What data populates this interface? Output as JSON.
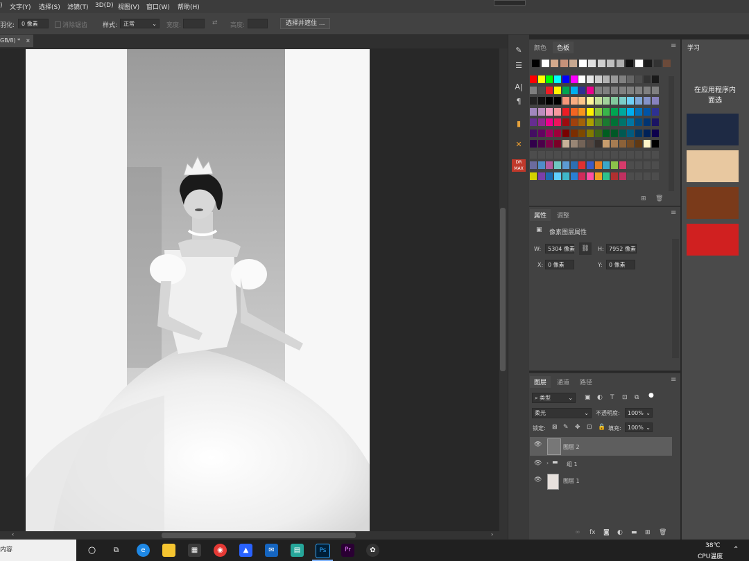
{
  "menubar": {
    "items": [
      "文字(Y)",
      "选择(S)",
      "滤镜(T)",
      "3D(D)",
      "视图(V)",
      "窗口(W)",
      "帮助(H)"
    ],
    "left_fragment": ")"
  },
  "options": {
    "feather_label": "羽化:",
    "feather_value": "0 像素",
    "antialias_label": "消除锯齿",
    "style_label": "样式:",
    "style_value": "正常",
    "width_label": "宽度:",
    "height_label": "高度:",
    "select_mask_btn": "选择并遮住 ..."
  },
  "document_tab": {
    "label": "GB/8) *",
    "close": "×"
  },
  "swatches_panel": {
    "tab_color": "颜色",
    "tab_swatches": "色板",
    "recent": [
      "#000000",
      "#ffffff",
      "#d4a98c",
      "#c6927a",
      "#c8a890",
      "#ffffff",
      "#e0e0e0",
      "#d0d0d0",
      "#c0c0c0",
      "#b0b0b0",
      "#111111",
      "#ffffff",
      "#1a1a1a",
      "#333333",
      "#6b4a3a"
    ],
    "rows": [
      [
        "#ff0000",
        "#ffff00",
        "#00ff00",
        "#00ffff",
        "#0000ff",
        "#ff00ff",
        "#ffffff",
        "#e6e6e6",
        "#cccccc",
        "#b3b3b3",
        "#999999",
        "#808080",
        "#666666",
        "#4d4d4d",
        "#333333",
        "#1a1a1a"
      ],
      [
        "#7f7f7f",
        "#4d4d4d",
        "#ed1c24",
        "#fff200",
        "#00a651",
        "#00aeef",
        "#2e3192",
        "#ec008c",
        "#808080",
        "#808080",
        "#808080",
        "#808080",
        "#808080",
        "#808080",
        "#808080",
        "#808080"
      ],
      [
        "#222222",
        "#111111",
        "#000000",
        "#000000",
        "#f7977a",
        "#f9ad81",
        "#fdc68a",
        "#fff79a",
        "#c4df9b",
        "#a2d39c",
        "#82ca9d",
        "#7bcdc8",
        "#6ecff6",
        "#7ea7d8",
        "#8493ca",
        "#8882be"
      ],
      [
        "#a187be",
        "#bc8dbf",
        "#f49ac2",
        "#f6989d",
        "#ed1c24",
        "#f26522",
        "#f7941d",
        "#fff200",
        "#8dc73f",
        "#39b54a",
        "#00a651",
        "#00a99d",
        "#00aeef",
        "#0072bc",
        "#0054a6",
        "#2e3192"
      ],
      [
        "#662d91",
        "#92278f",
        "#ec008c",
        "#ed145b",
        "#9e0b0f",
        "#a0410d",
        "#a36209",
        "#aba000",
        "#598527",
        "#1a7b30",
        "#007236",
        "#00746b",
        "#0076a3",
        "#004b80",
        "#003471",
        "#1b1464"
      ],
      [
        "#440e62",
        "#630460",
        "#9e005d",
        "#9e0039",
        "#790000",
        "#7b2e00",
        "#7d4900",
        "#827b00",
        "#406618",
        "#005e20",
        "#005826",
        "#005952",
        "#005b7f",
        "#003663",
        "#002157",
        "#0d004c"
      ],
      [
        "#32004b",
        "#4b0049",
        "#7b0046",
        "#7a0026",
        "#c7b299",
        "#998675",
        "#736357",
        "#534741",
        "#37302d",
        "#c69c6d",
        "#a67c52",
        "#8c6239",
        "#754c24",
        "#603913",
        "#fff6c9",
        "#000000"
      ],
      [
        "#4d4d4d",
        "#4d4d4d",
        "#4d4d4d",
        "#4d4d4d",
        "#4d4d4d",
        "#4d4d4d",
        "#4d4d4d",
        "#4d4d4d",
        "#4d4d4d",
        "#4d4d4d",
        "#4d4d4d",
        "#4d4d4d",
        "#4d4d4d",
        "#4d4d4d",
        "#4d4d4d",
        "#4d4d4d"
      ],
      [
        "#6b6b9e",
        "#4f8dc8",
        "#b45ca0",
        "#6fc7c1",
        "#5c9bd3",
        "#2d6fb2",
        "#e03030",
        "#3b5bc7",
        "#e67e22",
        "#3aa7c9",
        "#8bc34a",
        "#d63b6b",
        "#4d4d4d",
        "#4d4d4d",
        "#4d4d4d",
        "#4d4d4d"
      ],
      [
        "#d2d200",
        "#7b3fa8",
        "#1c6bb0",
        "#60d0ff",
        "#3fb7c8",
        "#2a7fd4",
        "#d02b5a",
        "#ff4fa3",
        "#f0a020",
        "#2ec28b",
        "#b03030",
        "#c03060",
        "#4d4d4d",
        "#4d4d4d",
        "#4d4d4d",
        "#4d4d4d"
      ]
    ]
  },
  "properties_panel": {
    "tab_properties": "属性",
    "tab_adjustments": "调整",
    "title": "像素图层属性",
    "w_label": "W:",
    "w_value": "5304 像素",
    "h_label": "H:",
    "h_value": "7952 像素",
    "x_label": "X:",
    "x_value": "0 像素",
    "y_label": "Y:",
    "y_value": "0 像素"
  },
  "layers_panel": {
    "tab_layers": "图层",
    "tab_channels": "通道",
    "tab_paths": "路径",
    "filter_kind": "类型",
    "blend_mode": "柔光",
    "opacity_label": "不透明度:",
    "opacity_value": "100%",
    "lock_label": "锁定:",
    "fill_label": "填充:",
    "fill_value": "100%",
    "layers": [
      {
        "name": "图层 2",
        "selected": true,
        "kind": "pixel"
      },
      {
        "name": "组 1",
        "selected": false,
        "kind": "group"
      },
      {
        "name": "图层 1",
        "selected": false,
        "kind": "photo"
      }
    ]
  },
  "learn_panel": {
    "tab": "学习",
    "text_line1": "在应用程序内",
    "text_line2": "面选"
  },
  "taskbar": {
    "search_fragment": "内容",
    "weather_temp": "38℃",
    "weather_label": "CPU温度"
  }
}
